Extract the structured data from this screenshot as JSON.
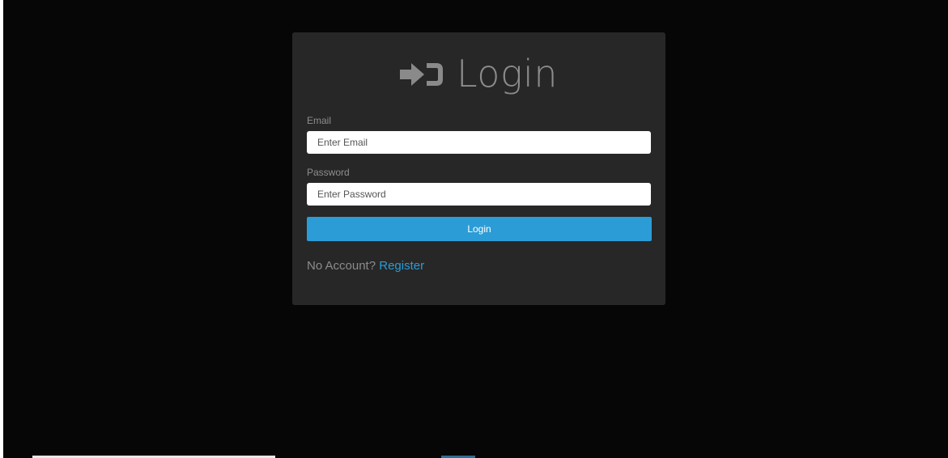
{
  "login_form": {
    "title": "Login",
    "title_icon": "sign-in-icon",
    "email": {
      "label": "Email",
      "placeholder": "Enter Email",
      "value": ""
    },
    "password": {
      "label": "Password",
      "placeholder": "Enter Password",
      "value": ""
    },
    "submit_label": "Login",
    "no_account_text": "No Account?",
    "register_link": "Register"
  },
  "colors": {
    "page_background": "#060606",
    "card_background": "#272727",
    "accent": "#2b9cd6",
    "muted_text": "#8c8c8c"
  }
}
